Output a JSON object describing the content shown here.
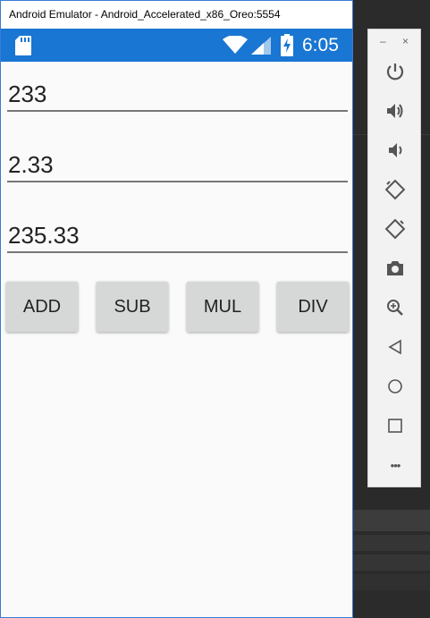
{
  "window": {
    "title": "Android Emulator - Android_Accelerated_x86_Oreo:5554"
  },
  "status_bar": {
    "time": "6:05",
    "icons": [
      "sd-card-icon",
      "wifi-icon",
      "signal-icon",
      "battery-charging-icon"
    ]
  },
  "fields": [
    {
      "value": "233"
    },
    {
      "value": "2.33"
    },
    {
      "value": "235.33"
    }
  ],
  "buttons": {
    "add": "ADD",
    "sub": "SUB",
    "mul": "MUL",
    "div": "DIV"
  },
  "toolbar": {
    "minimize": "–",
    "close": "×",
    "items": [
      "power-icon",
      "volume-up-icon",
      "volume-down-icon",
      "rotate-left-icon",
      "rotate-right-icon",
      "camera-icon",
      "zoom-icon",
      "back-icon",
      "home-icon",
      "overview-icon",
      "more-icon"
    ],
    "more_label": "•••"
  },
  "colors": {
    "status_bar": "#1976d2",
    "button": "#d6d7d7",
    "window_border": "#3b7bd4"
  }
}
